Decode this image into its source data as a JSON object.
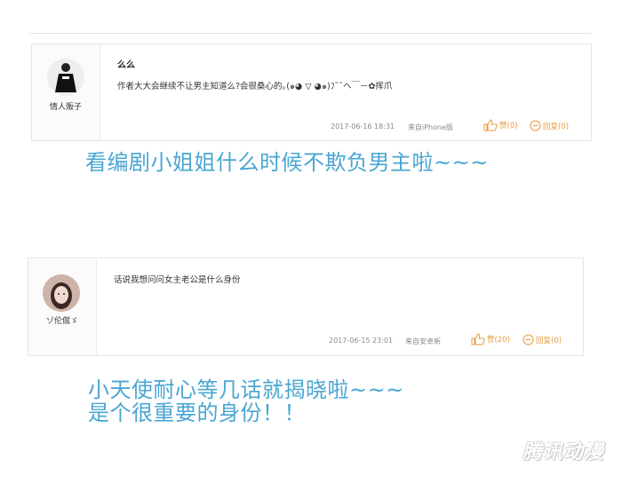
{
  "comments": [
    {
      "username": "情人贩子",
      "title": "么么",
      "body": "作者大大会继续不让男主知道么?会很桑心的｡(๑◕ ▽ ◕๑)ﾌ˘˘ヘ￣－✿挥爪",
      "date": "2017-06-16 18:31",
      "source": "来自iPhone版",
      "like_label": "赞(0)",
      "reply_label": "回复(0)",
      "avatar_icon": "avatar-black-dress-figure"
    },
    {
      "username": "ゾ伦僦ゞ",
      "title": "",
      "body": "话说我想问问女主老公是什么身份",
      "date": "2017-06-15 23:01",
      "source": "来自安卓新",
      "like_label": "赞(20)",
      "reply_label": "回复(0)",
      "avatar_icon": "avatar-girl-photo"
    }
  ],
  "captions": {
    "first": "看编剧小姐姐什么时候不欺负男主啦~~~",
    "second_line1": "小天使耐心等几话就揭晓啦~~~",
    "second_line2": "是个很重要的身份！！"
  },
  "watermark": "腾讯动漫",
  "colors": {
    "caption": "#4aa6d2",
    "action": "#e89a3e",
    "meta": "#8a8a8a"
  }
}
